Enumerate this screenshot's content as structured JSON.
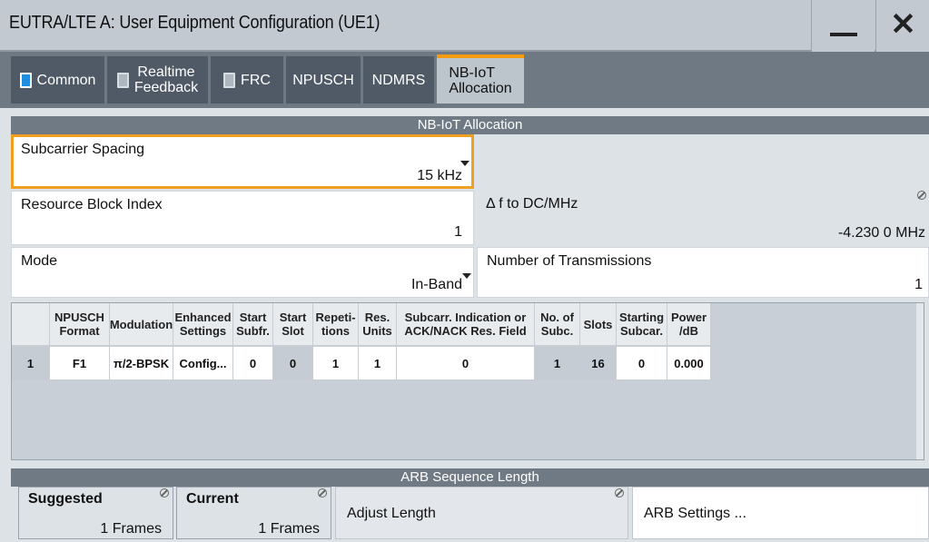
{
  "window": {
    "title": "EUTRA/LTE A: User Equipment Configuration (UE1)",
    "minimize_label": "—",
    "close_label": "✕"
  },
  "tabs": [
    {
      "label": "Common",
      "indicator": "on"
    },
    {
      "label1": "Realtime",
      "label2": "Feedback",
      "indicator": "off"
    },
    {
      "label": "FRC",
      "indicator": "off"
    },
    {
      "label": "NPUSCH"
    },
    {
      "label": "NDMRS"
    },
    {
      "label1": "NB-IoT",
      "label2": "Allocation",
      "active": true
    }
  ],
  "allocation": {
    "header": "NB-IoT Allocation",
    "subcarrier_spacing": {
      "label": "Subcarrier Spacing",
      "value": "15 kHz"
    },
    "resource_block_index": {
      "label": "Resource Block Index",
      "value": "1"
    },
    "delta_f": {
      "label": "Δ f to DC/MHz",
      "value": "-4.230 0 MHz"
    },
    "mode": {
      "label": "Mode",
      "value": "In-Band"
    },
    "num_transmissions": {
      "label": "Number of Transmissions",
      "value": "1"
    }
  },
  "table": {
    "headers": [
      {
        "l1": "",
        "l2": ""
      },
      {
        "l1": "NPUSCH",
        "l2": "Format"
      },
      {
        "l1": "Modulation",
        "l2": ""
      },
      {
        "l1": "Enhanced",
        "l2": "Settings"
      },
      {
        "l1": "Start",
        "l2": "Subfr."
      },
      {
        "l1": "Start",
        "l2": "Slot"
      },
      {
        "l1": "Repeti-",
        "l2": "tions"
      },
      {
        "l1": "Res.",
        "l2": "Units"
      },
      {
        "l1": "Subcarr. Indication or",
        "l2": "ACK/NACK Res. Field"
      },
      {
        "l1": "No. of",
        "l2": "Subc."
      },
      {
        "l1": "Slots",
        "l2": ""
      },
      {
        "l1": "Starting",
        "l2": "Subcar."
      },
      {
        "l1": "Power",
        "l2": "/dB"
      }
    ],
    "rows": [
      [
        "1",
        "F1",
        "π/2-BPSK",
        "Config...",
        "0",
        "0",
        "1",
        "1",
        "0",
        "1",
        "16",
        "0",
        "0.000"
      ]
    ]
  },
  "arb": {
    "header": "ARB Sequence Length",
    "suggested_label": "Suggested",
    "suggested_value": "1 Frames",
    "current_label": "Current",
    "current_value": "1 Frames",
    "adjust_label": "Adjust Length",
    "settings_label": "ARB Settings ..."
  },
  "colors": {
    "accent": "#f39c12",
    "indicator_on": "#1e8fe0",
    "header_bar": "#6f7a85",
    "tab_bg": "#4f5a66"
  }
}
